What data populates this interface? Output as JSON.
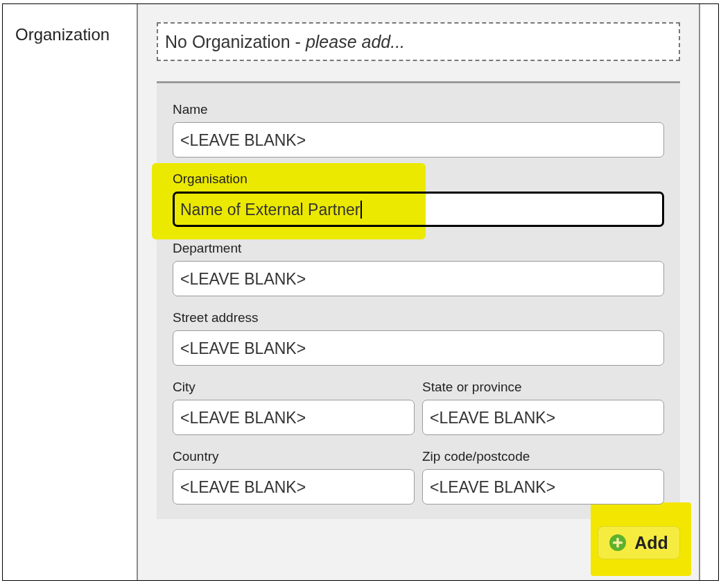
{
  "section": {
    "label": "Organization"
  },
  "organization_picker": {
    "text": "No Organization - *please add...*"
  },
  "form": {
    "rows": [
      [
        {
          "label": "Name",
          "value": "<LEAVE BLANK>",
          "focused": false,
          "highlighted": false
        }
      ],
      [
        {
          "label": "Organisation",
          "value": "Name of External Partner",
          "focused": true,
          "highlighted": true
        }
      ],
      [
        {
          "label": "Department",
          "value": "<LEAVE BLANK>",
          "focused": false,
          "highlighted": false
        }
      ],
      [
        {
          "label": "Street address",
          "value": "<LEAVE BLANK>",
          "focused": false,
          "highlighted": false
        }
      ],
      [
        {
          "label": "City",
          "value": "<LEAVE BLANK>",
          "focused": false,
          "highlighted": false
        },
        {
          "label": "State or province",
          "value": "<LEAVE BLANK>",
          "focused": false,
          "highlighted": false
        }
      ],
      [
        {
          "label": "Country",
          "value": "<LEAVE BLANK>",
          "focused": false,
          "highlighted": false
        },
        {
          "label": "Zip code/postcode",
          "value": "<LEAVE BLANK>",
          "focused": false,
          "highlighted": false
        }
      ]
    ]
  },
  "add_button": {
    "label": "Add",
    "highlighted": true
  }
}
